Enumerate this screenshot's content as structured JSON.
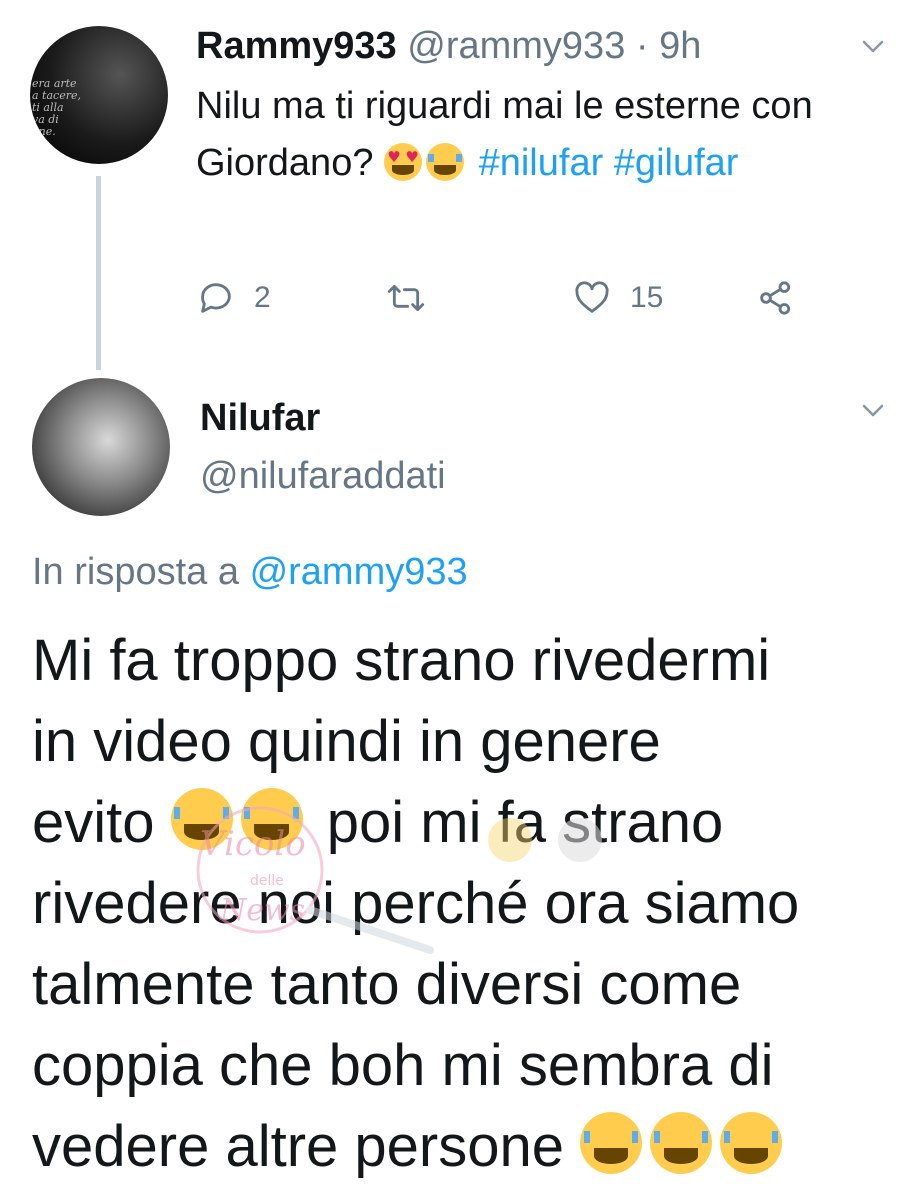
{
  "parent_tweet": {
    "avatar_text": "era arte\na tacere,\nti alla\nva di\none.",
    "name": "Rammy933",
    "handle": "@rammy933",
    "separator": "·",
    "time": "9h",
    "text_part1": "Nilu ma ti riguardi mai le esterne con Giordano?",
    "emojis_part1": [
      "smiling-face-with-heart-eyes",
      "face-with-tears-of-joy"
    ],
    "hashtag1": "#nilufar",
    "hashtag2": "#gilufar",
    "actions": {
      "reply_count": "2",
      "retweet_count": "",
      "like_count": "15"
    }
  },
  "reply_tweet": {
    "name": "Nilufar",
    "handle": "@nilufaraddati",
    "in_reply_prefix": "In risposta a",
    "in_reply_mention": "@rammy933",
    "text_line1": "Mi fa troppo strano rivedermi",
    "text_line2": "in video quindi in genere",
    "text_line3a": "evito",
    "text_line3b": "poi mi fa strano",
    "text_line4": "rivedere noi perché ora siamo",
    "text_line5": "talmente tanto diversi come",
    "text_line6": "coppia che boh mi sembra di",
    "text_line7": "vedere altre persone",
    "emojis": [
      "face-with-tears-of-joy",
      "face-with-tears-of-joy",
      "face-with-tears-of-joy",
      "face-with-tears-of-joy",
      "face-with-tears-of-joy"
    ]
  },
  "watermark": {
    "text1": "Vicolo",
    "text2": "delle",
    "text3": "News"
  },
  "colors": {
    "link": "#1da1f2",
    "meta": "#657786",
    "text": "#14171a",
    "thread_line": "#c9d3dc",
    "emoji_face": "#ffcc4d"
  }
}
